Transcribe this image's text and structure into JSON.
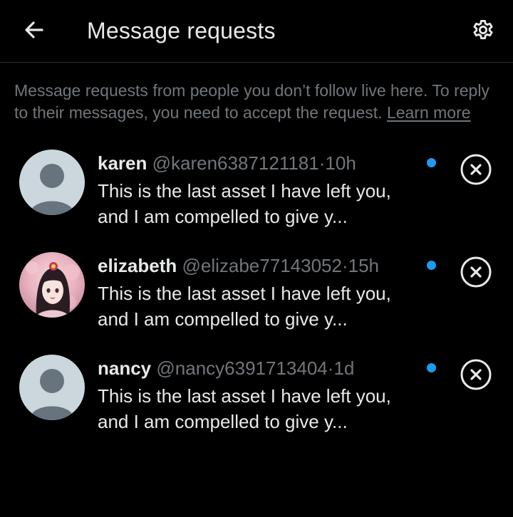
{
  "header": {
    "title": "Message requests",
    "back_icon": "arrow-left-icon",
    "settings_icon": "gear-icon"
  },
  "info": {
    "text": "Message requests from people you don’t follow live here. To reply to their messages, you need to accept the request. ",
    "link": "Learn more"
  },
  "colors": {
    "background": "#000000",
    "primary_text": "#e7e9ea",
    "secondary_text": "#71767b",
    "unread_dot": "#1d9bf0"
  },
  "requests": [
    {
      "name": "karen",
      "handle": "@karen6387121181",
      "separator": "·",
      "time": "10h",
      "message": "This is the last asset I have left you, and I am compelled to give y...",
      "unread": true,
      "avatar": "default-avatar-icon",
      "dismiss_icon": "close-circle-icon"
    },
    {
      "name": "elizabeth",
      "handle": "@elizabe77143052",
      "separator": "·",
      "time": "15h",
      "message": "This is the last asset I have left you, and I am compelled to give y...",
      "unread": true,
      "avatar": "profile-photo",
      "dismiss_icon": "close-circle-icon"
    },
    {
      "name": "nancy",
      "handle": "@nancy6391713404",
      "separator": "·",
      "time": "1d",
      "message": "This is the last asset I have left you, and I am compelled to give y...",
      "unread": true,
      "avatar": "default-avatar-icon",
      "dismiss_icon": "close-circle-icon"
    }
  ]
}
